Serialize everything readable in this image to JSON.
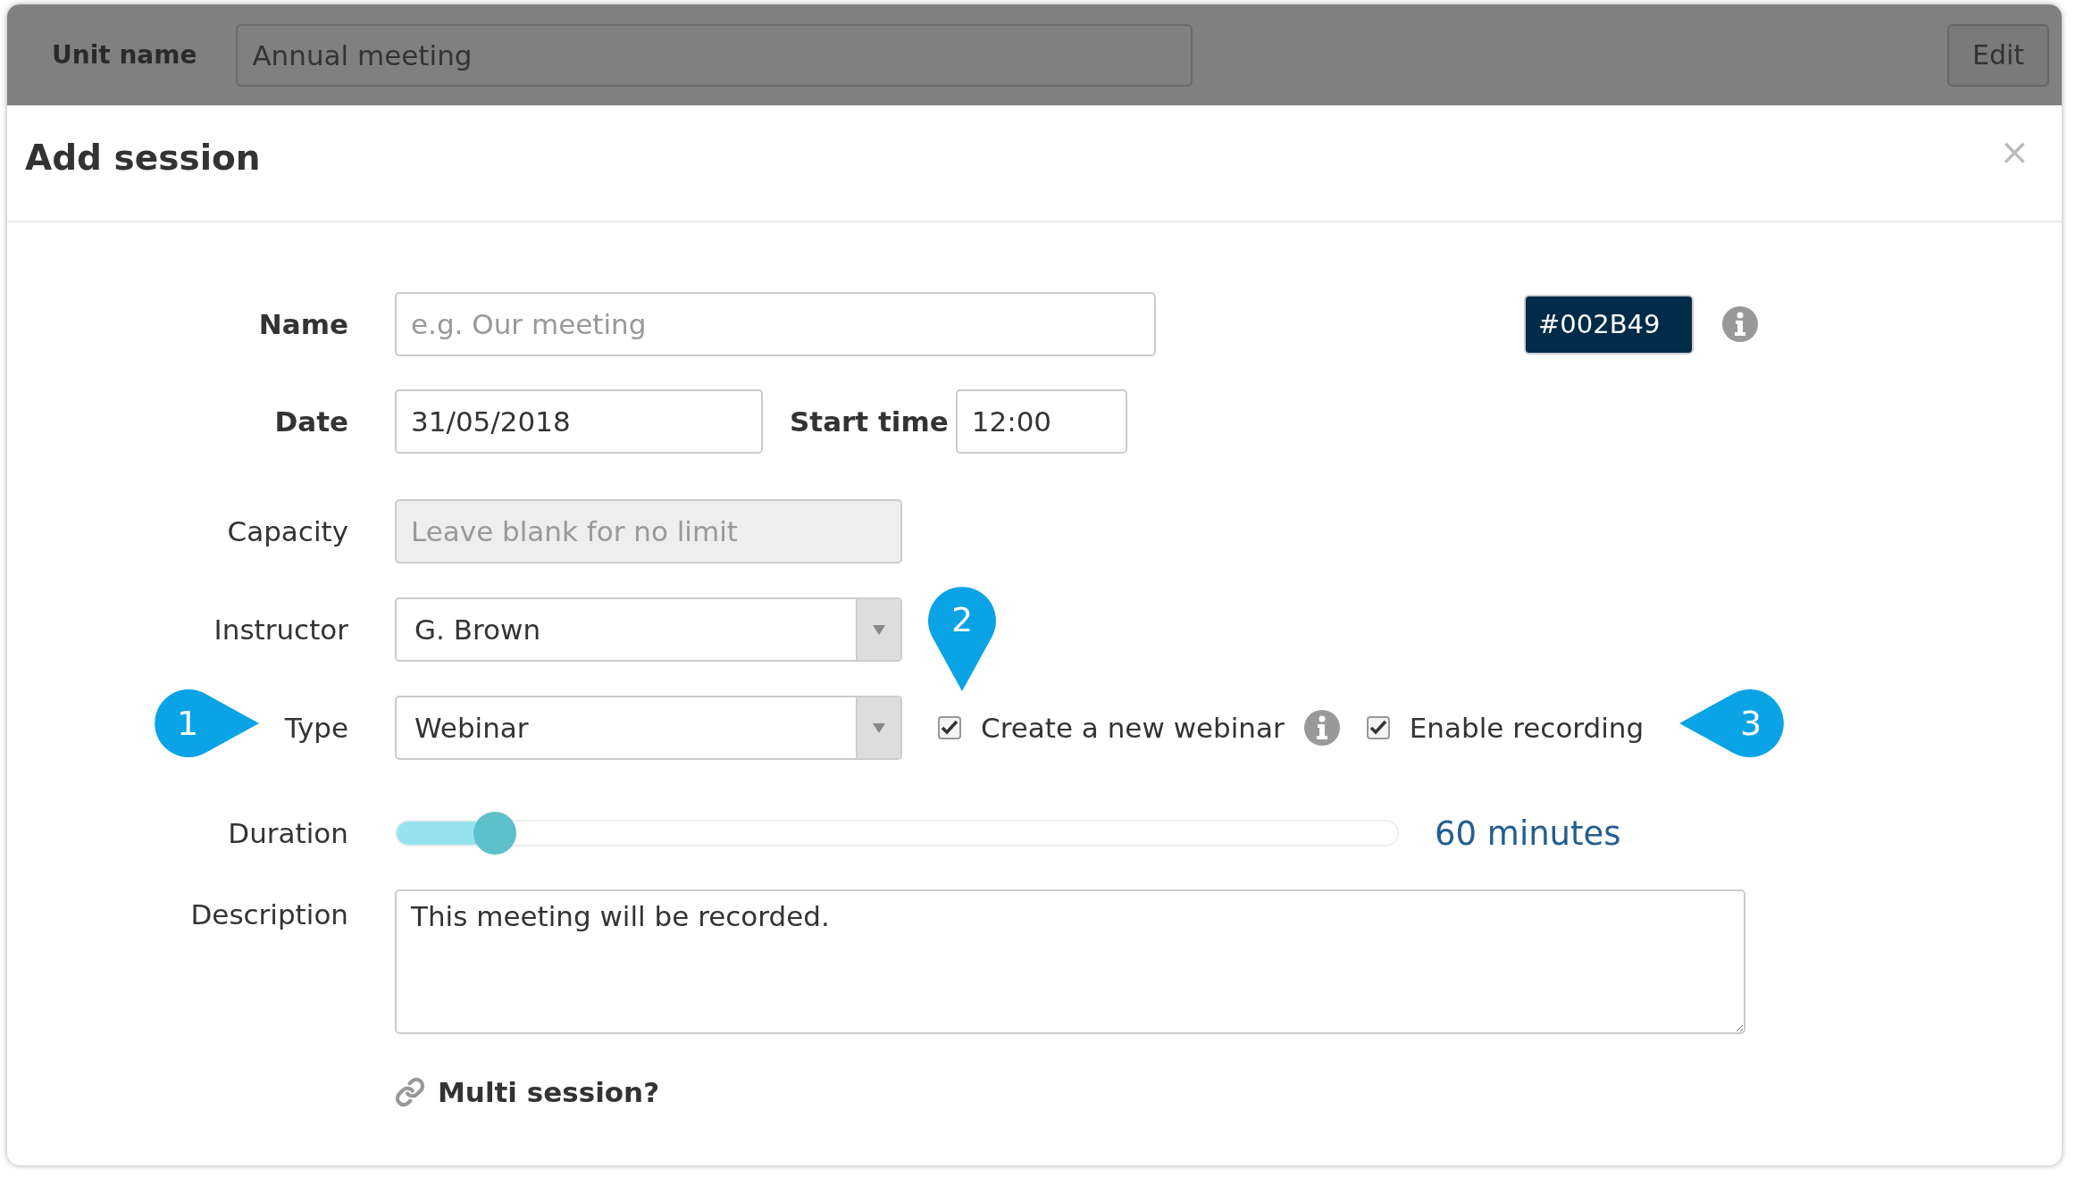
{
  "header": {
    "label": "Unit name",
    "value": "Annual meeting",
    "edit_button": "Edit"
  },
  "dialog": {
    "title": "Add session",
    "close": "×",
    "name": {
      "label": "Name",
      "placeholder": "e.g. Our meeting"
    },
    "color_badge": {
      "value": "#002B49",
      "info": true
    },
    "date": {
      "label": "Date",
      "value": "31/05/2018"
    },
    "start_time": {
      "label": "Start time",
      "value": "12:00"
    },
    "capacity": {
      "label": "Capacity",
      "placeholder": "Leave blank for no limit",
      "disabled": true
    },
    "instructor": {
      "label": "Instructor",
      "value": "G. Brown"
    },
    "type": {
      "label": "Type",
      "value": "Webinar"
    },
    "options": [
      {
        "label": "Create a new webinar",
        "checked": true,
        "info": true
      },
      {
        "label": "Enable recording",
        "checked": true,
        "info": false
      }
    ],
    "duration": {
      "label": "Duration",
      "level": 0.1,
      "reading": "60 minutes"
    },
    "description": {
      "label": "Description",
      "value": "This meeting will be recorded."
    },
    "multi_session": "Multi session?"
  },
  "callouts": [
    {
      "number": "1",
      "kind": "right"
    },
    {
      "number": "2",
      "kind": "down"
    },
    {
      "number": "3",
      "kind": "left"
    }
  ]
}
